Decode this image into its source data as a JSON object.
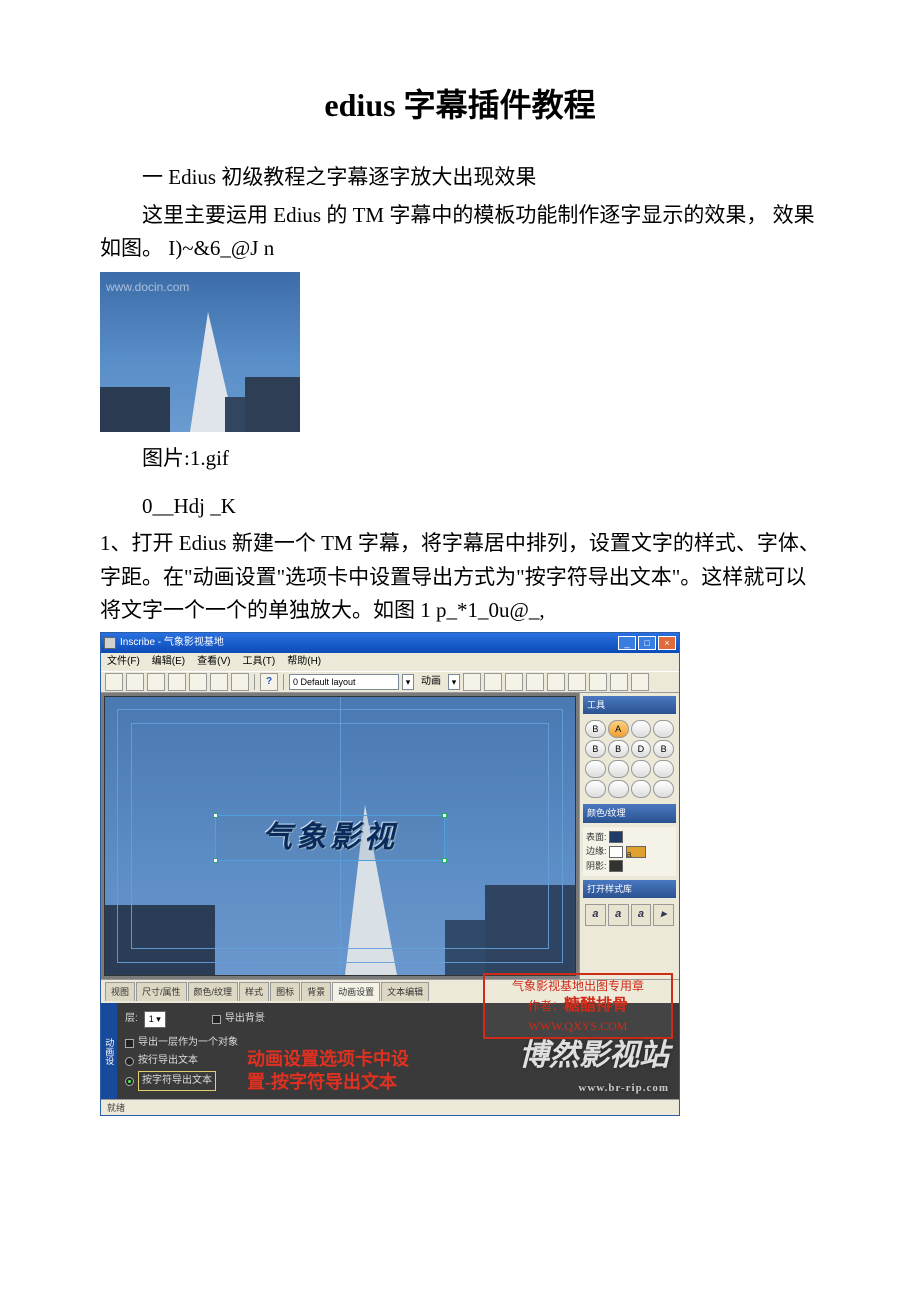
{
  "title": "edius 字幕插件教程",
  "p1": "一 Edius 初级教程之字幕逐字放大出现效果",
  "p2": "这里主要运用 Edius 的 TM 字幕中的模板功能制作逐字显示的效果， 效果如图。 I)~&6_@J n",
  "img1_caption": "图片:1.gif",
  "p3": "0__Hdj _K",
  "p4": "1、打开 Edius 新建一个 TM 字幕，将字幕居中排列，设置文字的样式、字体、字距。在\"动画设置\"选项卡中设置导出方式为\"按字符导出文本\"。这样就可以将文字一个一个的单独放大。如图 1 p_*1_0u@_,",
  "img1_watermark": "www.docin.com",
  "screenshot": {
    "window_title": "Inscribe - 气象影视基地",
    "menu": [
      "文件(F)",
      "编辑(E)",
      "查看(V)",
      "工具(T)",
      "帮助(H)"
    ],
    "layout_dropdown": "0 Default layout",
    "anim_label": "动画",
    "canvas_text": "气象影视",
    "right": {
      "panel1": "工具",
      "grid_labels": [
        "B",
        "A",
        "",
        "",
        "B",
        "B",
        "D",
        "B",
        "",
        "",
        "",
        ""
      ],
      "panel2": "颜色/纹理",
      "surface": "表面:",
      "edge": "边缘:",
      "shadow": "阴影:",
      "panel3": "打开样式库",
      "style_a": "a"
    },
    "tabs": [
      "视图",
      "尺寸/属性",
      "颜色/纹理",
      "样式",
      "图标",
      "背景",
      "动画设置",
      "文本编辑"
    ],
    "bottom": {
      "vtab": "动画设",
      "layer_label": "层:",
      "layer_value": "1",
      "export_bg": "导出背景",
      "opt1": "导出一层作为一个对象",
      "opt2": "按行导出文本",
      "opt3": "按字符导出文本",
      "anno_line1": "动画设置选项卡中设",
      "anno_line2": "置-按字符导出文本"
    },
    "stamp": {
      "line1": "气象影视基地出图专用章",
      "line2_label": "作者：",
      "line2_value": "糖醋排骨",
      "line3": "WWW.QXYS.COM"
    },
    "watermark": "博然影视站",
    "watermark_url": "www.br-rip.com",
    "status": "就绪"
  }
}
